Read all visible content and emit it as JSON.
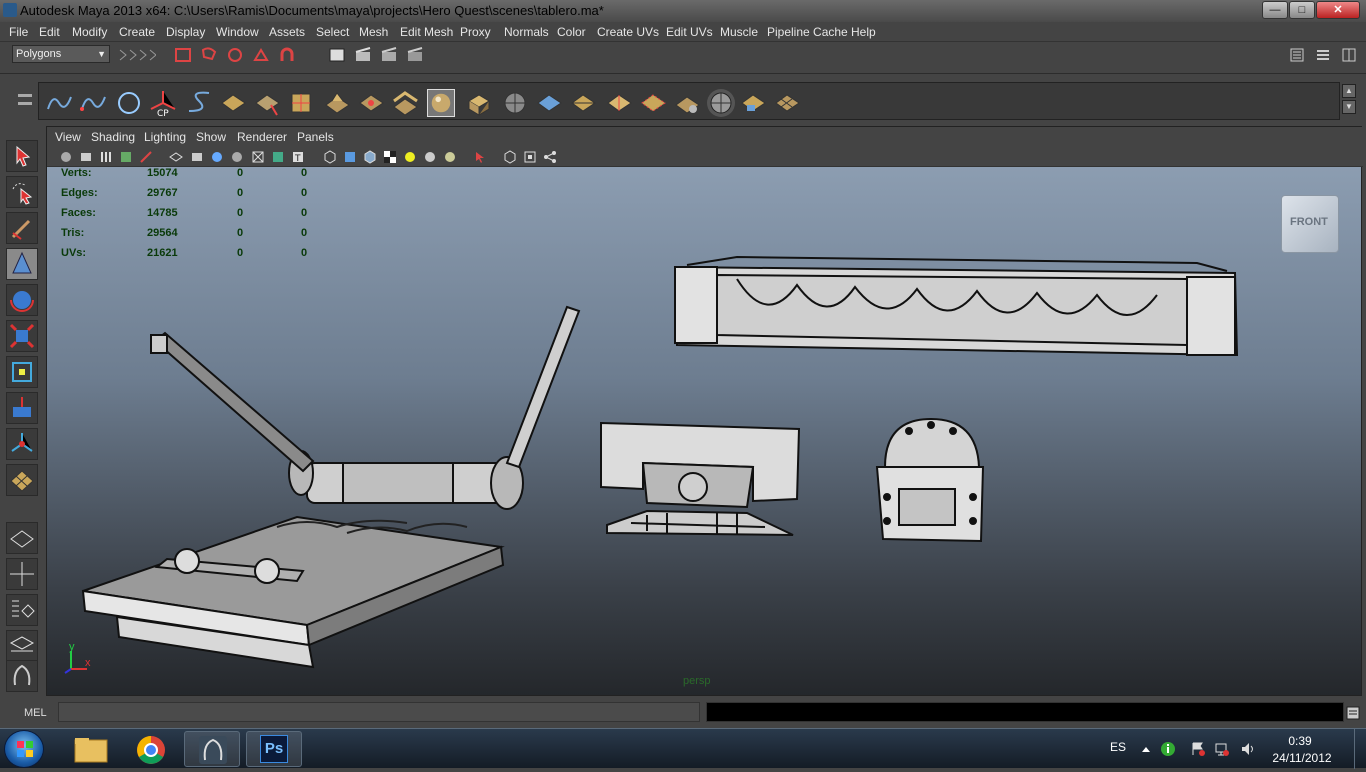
{
  "window": {
    "title": "Autodesk Maya 2013 x64: C:\\Users\\Ramis\\Documents\\maya\\projects\\Hero Quest\\scenes\\tablero.ma*",
    "minimize": "—",
    "maximize": "□",
    "close": "✕"
  },
  "menu": [
    "File",
    "Edit",
    "Modify",
    "Create",
    "Display",
    "Window",
    "Assets",
    "Select",
    "Mesh",
    "Edit Mesh",
    "Proxy",
    "Normals",
    "Color",
    "Create UVs",
    "Edit UVs",
    "Muscle",
    "Pipeline Cache",
    "Help"
  ],
  "statusline": {
    "mode": "Polygons"
  },
  "panel_menu": [
    "View",
    "Shading",
    "Lighting",
    "Show",
    "Renderer",
    "Panels"
  ],
  "hud": {
    "rows": [
      {
        "label": "Verts:",
        "total": "15074",
        "selected": "0",
        "extra": "0"
      },
      {
        "label": "Edges:",
        "total": "29767",
        "selected": "0",
        "extra": "0"
      },
      {
        "label": "Faces:",
        "total": "14785",
        "selected": "0",
        "extra": "0"
      },
      {
        "label": "Tris:",
        "total": "29564",
        "selected": "0",
        "extra": "0"
      },
      {
        "label": "UVs:",
        "total": "21621",
        "selected": "0",
        "extra": "0"
      }
    ]
  },
  "viewcube": {
    "face": "FRONT"
  },
  "camera": "persp",
  "axis": {
    "y": "y",
    "x": "x"
  },
  "cmdline": {
    "label": "MEL"
  },
  "taskbar": {
    "language": "ES",
    "time": "0:39",
    "date": "24/11/2012",
    "ps_label": "Ps"
  },
  "colors": {
    "viewport_top": "#8c9db1",
    "viewport_bottom": "#24272b",
    "hud_text": "#0a3a0a"
  }
}
